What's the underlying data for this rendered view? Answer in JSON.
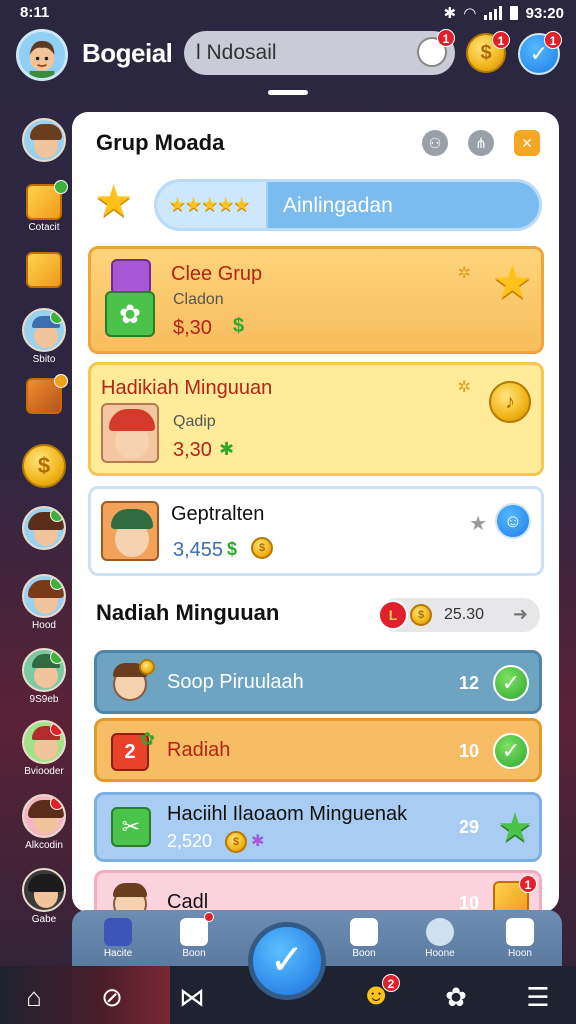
{
  "status": {
    "time": "8:11",
    "clock": "93:20"
  },
  "top": {
    "name": "Bogeial",
    "search_value": "l Ndosail",
    "badge_search": "1",
    "badge_coin": "1",
    "badge_check": "1"
  },
  "panel": {
    "title": "Grup Moada",
    "progress": {
      "stars": "★★★★★",
      "label": "Ainlingadan",
      "level": 0.29
    },
    "cards": [
      {
        "name": "Clee Grup",
        "sub": "Cladon",
        "amount": "$,30"
      },
      {
        "name": "Hadikiah Minguuan",
        "sub": "Qadip",
        "amount": "3,30"
      },
      {
        "name": "Geptralten",
        "amount": "3,455"
      }
    ],
    "section_title": "Nadiah Minguuan",
    "section_value": "25.30",
    "rows": [
      {
        "label": "Soop Piruulaah",
        "num": "12",
        "color": "#6ea3c2"
      },
      {
        "label": "Radiah",
        "num": "10",
        "color": "#f7bd64"
      },
      {
        "label": "Haciihl Ilaoaom Minguenak",
        "sub": "2,520",
        "num": "29",
        "color": "#a9cdf2"
      },
      {
        "label": "Cadl",
        "num": "10",
        "color": "#fbd3de"
      }
    ]
  },
  "sidebar": [
    "Cotacit",
    "Sbito",
    "Hood",
    "9S9eb",
    "Bviooder",
    "Alkcodin",
    "Gabe"
  ],
  "tabs": [
    "Hacite",
    "Boon",
    "Boon",
    "Hoone",
    "Hoon"
  ],
  "nav_badge": "2",
  "colors": {
    "accent_blue": "#1e7ee8",
    "gold": "#f1b417",
    "green": "#2fa82e"
  }
}
